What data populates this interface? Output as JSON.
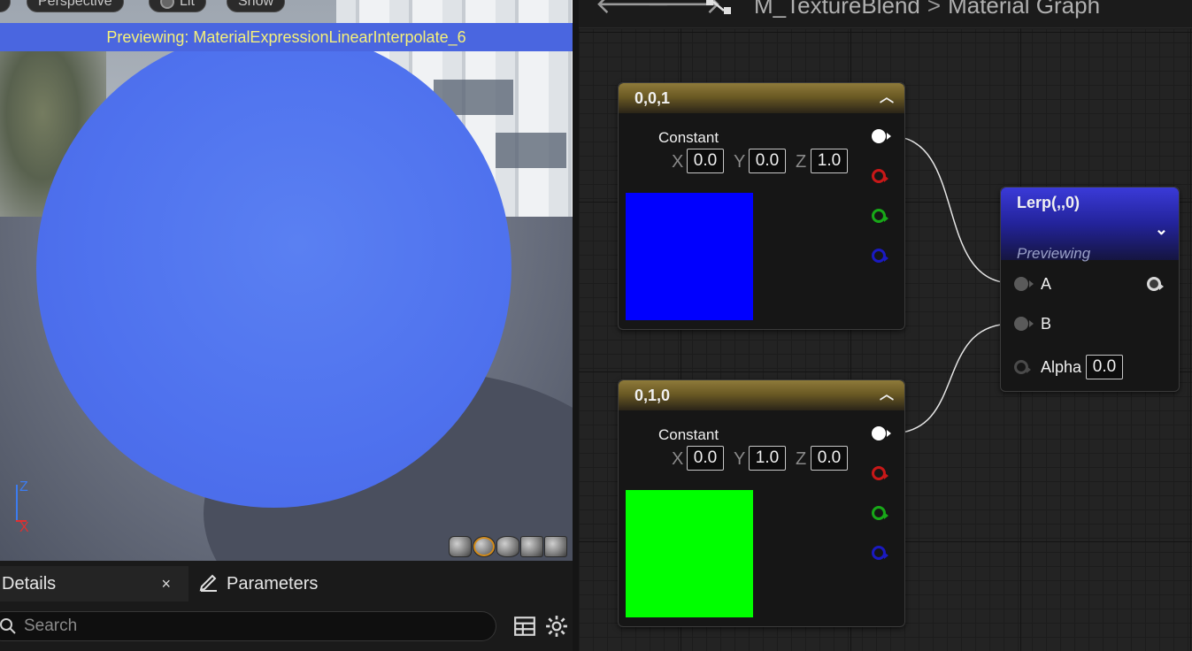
{
  "viewport": {
    "toolbar": {
      "perspective": "Perspective",
      "lit": "Lit",
      "show": "Show"
    },
    "preview_banner": "Previewing: MaterialExpressionLinearInterpolate_6",
    "axis": {
      "z": "Z",
      "x": "X"
    },
    "preview_shapes": [
      "cylinder",
      "sphere",
      "plane",
      "cube",
      "mesh"
    ],
    "active_shape": "sphere",
    "sphere_color": "#4f72ee"
  },
  "details_panel": {
    "tabs": {
      "details": "Details",
      "details_close": "×",
      "parameters": "Parameters"
    },
    "search": {
      "placeholder": "Search"
    }
  },
  "graph": {
    "breadcrumb": {
      "asset": "M_TextureBlend",
      "separator": ">",
      "view": "Material Graph"
    },
    "nodes": {
      "constant_blue": {
        "title": "0,0,1",
        "type_label": "Constant",
        "x_label": "X",
        "x": "0.0",
        "y_label": "Y",
        "y": "0.0",
        "z_label": "Z",
        "z": "1.0",
        "swatch_color": "#0000ff"
      },
      "constant_green": {
        "title": "0,1,0",
        "type_label": "Constant",
        "x_label": "X",
        "x": "0.0",
        "y_label": "Y",
        "y": "1.0",
        "z_label": "Z",
        "z": "0.0",
        "swatch_color": "#00ff00"
      },
      "lerp": {
        "title": "Lerp(,,0)",
        "status": "Previewing",
        "pins": {
          "a": "A",
          "b": "B",
          "alpha": "Alpha"
        },
        "alpha_value": "0.0"
      }
    }
  }
}
